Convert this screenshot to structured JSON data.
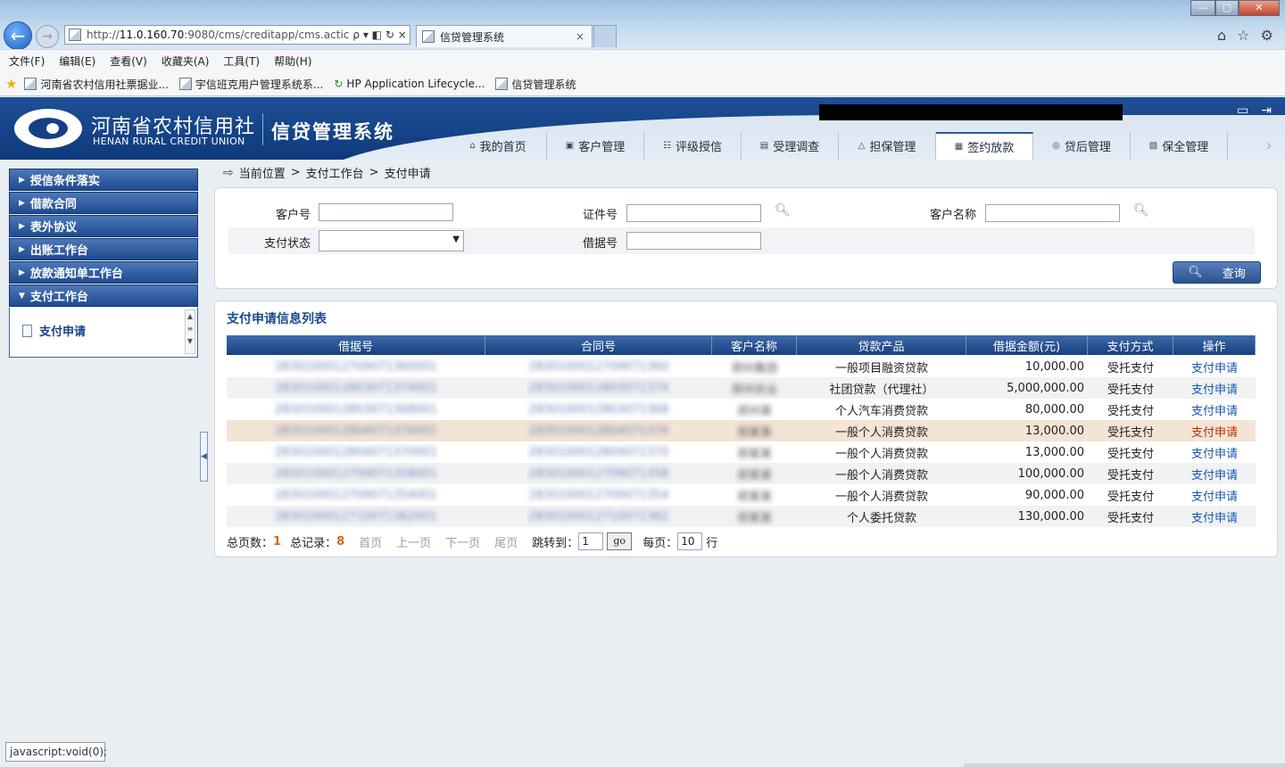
{
  "browser": {
    "url_prefix": "http://",
    "url_host": "11.0.160.70",
    "url_rest": ":9080/cms/creditapp/cms.actic",
    "tab_title": "信贷管理系统",
    "tab_close": "×",
    "addr_tools": "ρ ▾ ◧ ↻ ×",
    "win_min": "—",
    "win_max": "▢",
    "win_close": "✕",
    "home_icon": "⌂",
    "fav_icon": "☆",
    "gear_icon": "⚙"
  },
  "menu": [
    "文件(F)",
    "编辑(E)",
    "查看(V)",
    "收藏夹(A)",
    "工具(T)",
    "帮助(H)"
  ],
  "favorites": [
    "河南省农村信用社票据业...",
    "宇信班克用户管理系统系...",
    "HP Application Lifecycle...",
    "信贷管理系统"
  ],
  "app": {
    "org_cn": "河南省农村信用社",
    "org_en": "HENAN RURAL CREDIT UNION",
    "system": "信贷管理系统",
    "nav": [
      {
        "icon": "home-icon",
        "glyph": "⌂",
        "label": "我的首页"
      },
      {
        "icon": "customer-icon",
        "glyph": "▣",
        "label": "客户管理"
      },
      {
        "icon": "rating-icon",
        "glyph": "☷",
        "label": "评级授信"
      },
      {
        "icon": "survey-icon",
        "glyph": "▤",
        "label": "受理调查"
      },
      {
        "icon": "guarantee-icon",
        "glyph": "△",
        "label": "担保管理"
      },
      {
        "icon": "contract-icon",
        "glyph": "▦",
        "label": "签约放款"
      },
      {
        "icon": "postloan-icon",
        "glyph": "◎",
        "label": "贷后管理"
      },
      {
        "icon": "preserve-icon",
        "glyph": "▧",
        "label": "保全管理"
      }
    ],
    "active_nav": 5,
    "nav_more": "›"
  },
  "sidebar": {
    "items": [
      "授信条件落实",
      "借款合同",
      "表外协议",
      "出账工作台",
      "放款通知单工作台"
    ],
    "open_item": "支付工作台",
    "sub_items": [
      "支付申请"
    ]
  },
  "breadcrumb": {
    "prefix": "当前位置",
    "path": [
      "支付工作台",
      "支付申请"
    ],
    "sep": ">"
  },
  "search": {
    "customer_no_label": "客户号",
    "customer_no_value": "",
    "id_no_label": "证件号",
    "id_no_value": "",
    "customer_name_label": "客户名称",
    "customer_name_value": "",
    "pay_status_label": "支付状态",
    "pay_status_value": "",
    "receipt_no_label": "借据号",
    "receipt_no_value": "",
    "query_label": "查询"
  },
  "list": {
    "title": "支付申请信息列表",
    "columns": [
      "借据号",
      "合同号",
      "客户名称",
      "贷款产品",
      "借据金额(元)",
      "支付方式",
      "操作"
    ],
    "rows": [
      {
        "receipt": "2830100012709071360001",
        "contract": "2830100012709071360",
        "name": "郑州集团",
        "product": "一般项目融资贷款",
        "amount": "10,000.00",
        "method": "受托支付",
        "action": "支付申请"
      },
      {
        "receipt": "2830100012803071374001",
        "contract": "2830100012803071374",
        "name": "郑州农业",
        "product": "社团贷款（代理社）",
        "amount": "5,000,000.00",
        "method": "受托支付",
        "action": "支付申请"
      },
      {
        "receipt": "2830100012803071368001",
        "contract": "2830100012803071368",
        "name": "郑州某",
        "product": "个人汽车消费贷款",
        "amount": "80,000.00",
        "method": "受托支付",
        "action": "支付申请"
      },
      {
        "receipt": "2830100012804071376001",
        "contract": "2830100012804071376",
        "name": "郑某某",
        "product": "一般个人消费贷款",
        "amount": "13,000.00",
        "method": "受托支付",
        "action": "支付申请"
      },
      {
        "receipt": "2830100012804071370001",
        "contract": "2830100012804071370",
        "name": "郑某某",
        "product": "一般个人消费贷款",
        "amount": "13,000.00",
        "method": "受托支付",
        "action": "支付申请"
      },
      {
        "receipt": "2830100012709071358001",
        "contract": "2830100012709071358",
        "name": "郑某某",
        "product": "一般个人消费贷款",
        "amount": "100,000.00",
        "method": "受托支付",
        "action": "支付申请"
      },
      {
        "receipt": "2830100012709071354001",
        "contract": "2830100012709071354",
        "name": "郑某某",
        "product": "一般个人消费贷款",
        "amount": "90,000.00",
        "method": "受托支付",
        "action": "支付申请"
      },
      {
        "receipt": "2830100012710071362001",
        "contract": "2830100012710071362",
        "name": "郑某某",
        "product": "个人委托贷款",
        "amount": "130,000.00",
        "method": "受托支付",
        "action": "支付申请"
      }
    ],
    "highlight_row": 3
  },
  "pager": {
    "total_pages_label": "总页数：",
    "total_pages": "1",
    "total_records_label": "总记录：",
    "total_records": "8",
    "first": "首页",
    "prev": "上一页",
    "next": "下一页",
    "last": "尾页",
    "jump_label": "跳转到：",
    "jump_value": "1",
    "go": "go",
    "per_page_label": "每页：",
    "per_page_value": "10",
    "per_page_unit": "行"
  },
  "status_bar": "javascript:void(0);",
  "colors": {
    "header": "#1f4f96",
    "accent": "#1d4a8a",
    "highlight_row": "#f3e4d4",
    "count": "#d2691e"
  }
}
